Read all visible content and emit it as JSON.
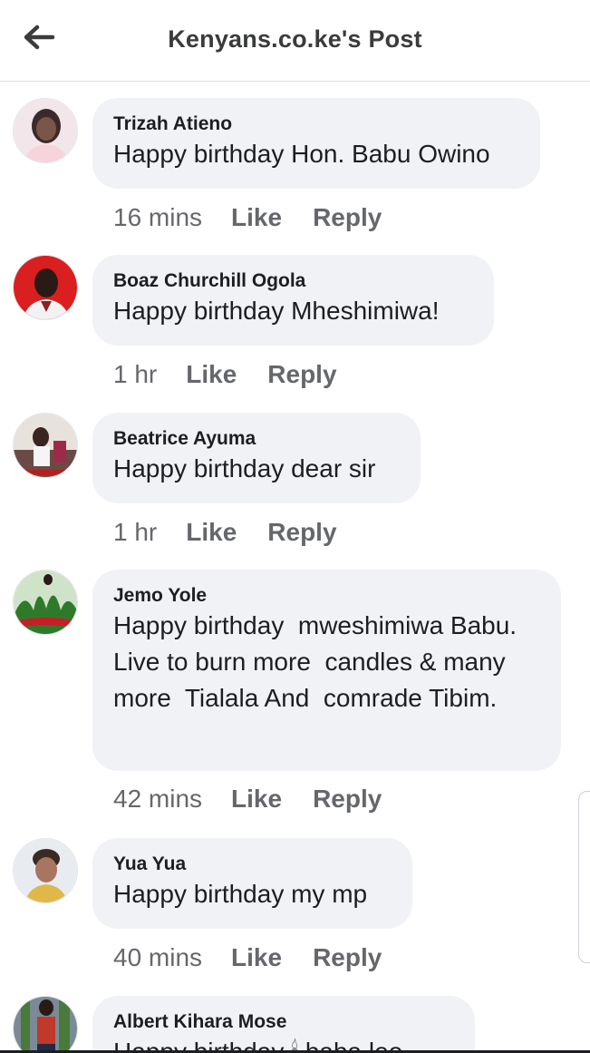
{
  "header": {
    "title": "Kenyans.co.ke's Post",
    "back_icon": "arrow-left-icon"
  },
  "comments": [
    {
      "author": "Trizah Atieno",
      "text": "Happy birthday Hon. Babu Owino",
      "time": "16 mins",
      "like": "Like",
      "reply": "Reply",
      "avatar_colors": {
        "bg": "#f4e4e8",
        "fg": "#3b2a2a"
      }
    },
    {
      "author": "Boaz Churchill Ogola",
      "text": "Happy birthday Mheshimiwa!",
      "time": "1 hr",
      "like": "Like",
      "reply": "Reply",
      "avatar_colors": {
        "bg": "#d91f1f",
        "fg": "#2a1a16"
      }
    },
    {
      "author": "Beatrice Ayuma",
      "text": "Happy birthday dear sir",
      "time": "1 hr",
      "like": "Like",
      "reply": "Reply",
      "avatar_colors": {
        "bg": "#6b4a45",
        "fg": "#e8e2dc"
      }
    },
    {
      "author": "Jemo Yole",
      "text": "Happy birthday  mweshimiwa Babu. Live to burn more  candles & many more  Tialala And  comrade Tibim.",
      "time": "42 mins",
      "like": "Like",
      "reply": "Reply",
      "avatar_colors": {
        "bg": "#2f7a2a",
        "fg": "#c81d25"
      }
    },
    {
      "author": "Yua Yua",
      "text": "Happy birthday my mp",
      "time": "40 mins",
      "like": "Like",
      "reply": "Reply",
      "avatar_colors": {
        "bg": "#e8ecf1",
        "fg": "#3a2a22"
      }
    },
    {
      "author": "Albert Kihara Mose",
      "text": "Happy birthday 🕯 baba leo",
      "avatar_colors": {
        "bg": "#7a8a96",
        "fg": "#c0392b"
      }
    }
  ]
}
